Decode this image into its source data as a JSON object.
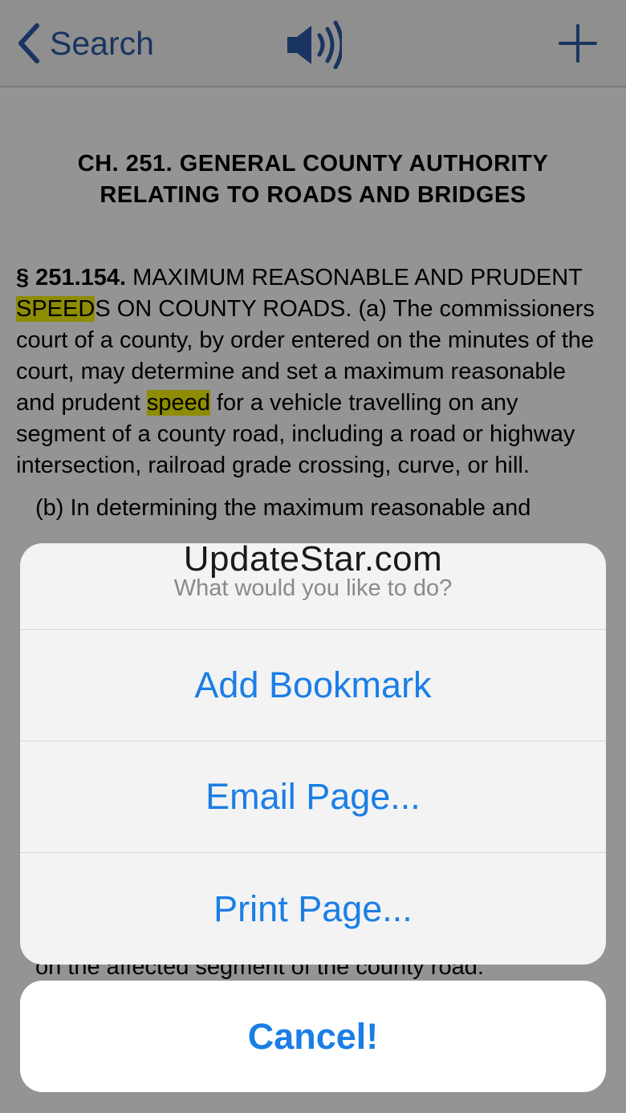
{
  "navbar": {
    "back_label": "Search",
    "speaker_icon": "speaker-icon",
    "add_icon": "plus-icon",
    "accent_color": "#2b5aa6"
  },
  "document": {
    "chapter_title_line1": "CH. 251. GENERAL COUNTY AUTHORITY",
    "chapter_title_line2": "RELATING TO ROADS AND BRIDGES",
    "section_number": "§ 251.154.",
    "section_text_1": " MAXIMUM REASONABLE AND PRUDENT ",
    "highlight_1": "SPEED",
    "section_text_2": "S ON COUNTY ROADS. (a) The commissioners court of a county, by order entered on the minutes of the court, may determine and set a maximum reasonable and prudent ",
    "highlight_2": "speed",
    "section_text_3": " for a vehicle travelling on any segment of a county road, including a road or highway intersection, railroad grade crossing, curve, or hill.",
    "para_b": "(b) In determining the maximum reasonable and",
    "bottom_line": "on the affected segment of the county road.",
    "highlight_color": "#f5f106"
  },
  "action_sheet": {
    "message": "What would you like to do?",
    "buttons": [
      "Add Bookmark",
      "Email Page...",
      "Print Page..."
    ],
    "cancel": "Cancel!",
    "button_color": "#1a7ee6"
  },
  "watermark": "UpdateStar.com"
}
